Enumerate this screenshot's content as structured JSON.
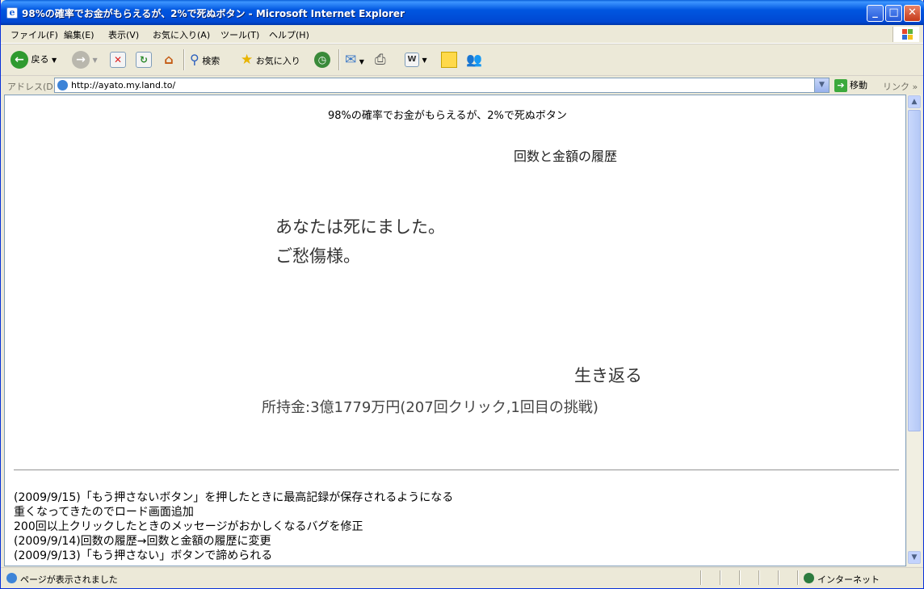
{
  "window": {
    "title": "98%の確率でお金がもらえるが、2%で死ぬボタン - Microsoft Internet Explorer",
    "minimize": "_",
    "maximize": "□",
    "close": "✕"
  },
  "menu": [
    "ファイル(F)",
    "編集(E)",
    "表示(V)",
    "お気に入り(A)",
    "ツール(T)",
    "ヘルプ(H)"
  ],
  "toolbar": {
    "back": "戻る",
    "search": "検索",
    "favorites": "お気に入り"
  },
  "address": {
    "label": "アドレス(D)",
    "url": "http://ayato.my.land.to/",
    "go": "移動",
    "links": "リンク »"
  },
  "page": {
    "heading": "98%の確率でお金がもらえるが、2%で死ぬボタン",
    "history_link": "回数と金額の履歴",
    "death_line1": "あなたは死にました。",
    "death_line2": "ご愁傷様。",
    "revive": "生き返る",
    "money": "所持金:3億1779万円(207回クリック,1回目の挑戦)",
    "changelog": [
      "(2009/9/15)「もう押さないボタン」を押したときに最高記録が保存されるようになる",
      "重くなってきたのでロード画面追加",
      "200回以上クリックしたときのメッセージがおかしくなるバグを修正",
      "(2009/9/14)回数の履歴→回数と金額の履歴に変更",
      "(2009/9/13)「もう押さない」ボタンで諦められる"
    ]
  },
  "status": {
    "text": "ページが表示されました",
    "zone": "インターネット"
  },
  "colors": {
    "titlebar": "#0054e3",
    "chrome": "#ece9d8",
    "content_bg": "#ffffff"
  }
}
